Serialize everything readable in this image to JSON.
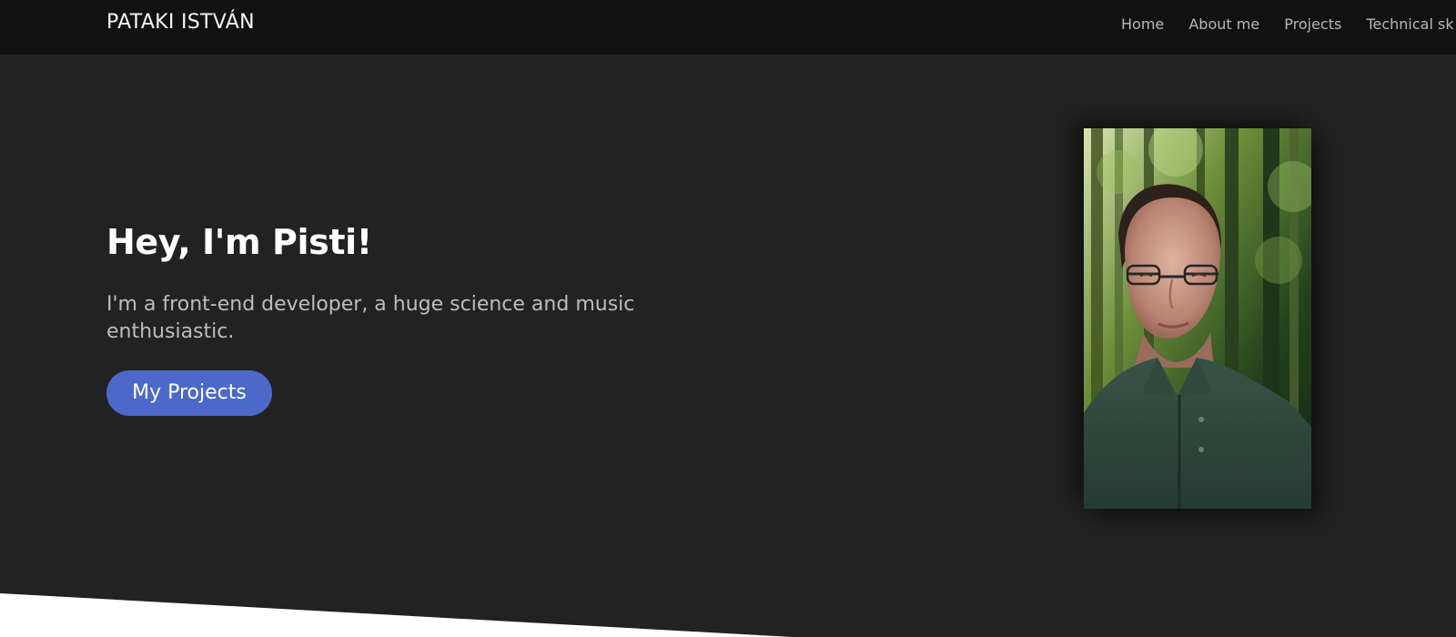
{
  "header": {
    "brand": "PATAKI ISTVÁN",
    "nav": [
      {
        "label": "Home"
      },
      {
        "label": "About me"
      },
      {
        "label": "Projects"
      },
      {
        "label": "Technical sk"
      }
    ]
  },
  "hero": {
    "title": "Hey, I'm Pisti!",
    "subtitle": "I'm a front-end developer, a huge science and music enthusiastic.",
    "button_label": "My Projects"
  },
  "colors": {
    "page_background": "#222222",
    "header_background": "#111111",
    "button_background": "#4c68c9",
    "heading_text": "#ffffff",
    "body_text": "#bdbdbd",
    "bottom_shape": "#ffffff"
  },
  "images": {
    "portrait": "developer-portrait-in-green-park"
  }
}
